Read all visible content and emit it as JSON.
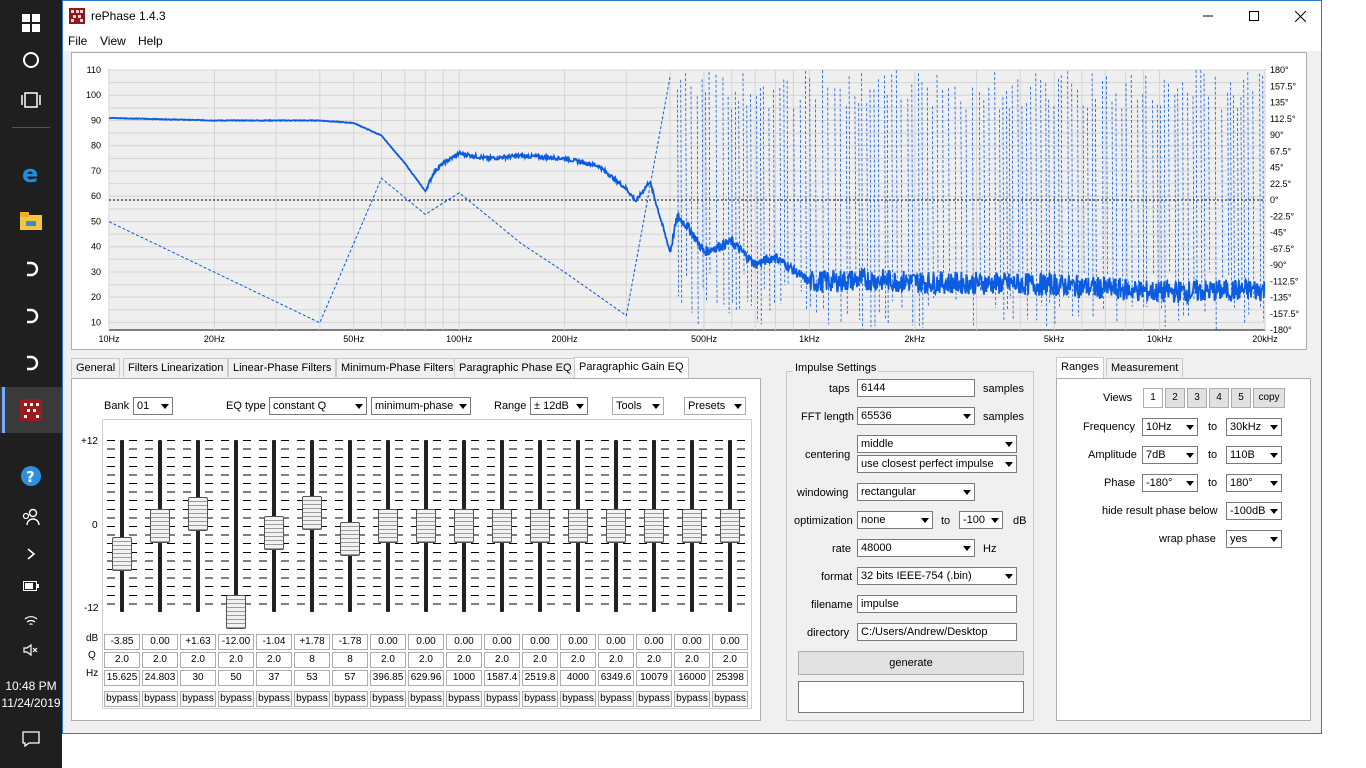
{
  "app": {
    "title": "rePhase 1.4.3"
  },
  "menu": [
    "File",
    "View",
    "Help"
  ],
  "chart_data": {
    "type": "line",
    "title": "",
    "x_ticks": [
      "10Hz",
      "20Hz",
      "50Hz",
      "100Hz",
      "200Hz",
      "500Hz",
      "1kHz",
      "2kHz",
      "5kHz",
      "10kHz",
      "20kHz"
    ],
    "x_range": [
      10,
      20000
    ],
    "y_left_ticks": [
      "110",
      "100",
      "90",
      "80",
      "70",
      "60",
      "50",
      "40",
      "30",
      "20",
      "10"
    ],
    "y_left_range": [
      7,
      110
    ],
    "y_right_ticks": [
      "180°",
      "157.5°",
      "135°",
      "112.5°",
      "90°",
      "67.5°",
      "45°",
      "22.5°",
      "0°",
      "-22.5°",
      "-45°",
      "-67.5°",
      "-90°",
      "-112.5°",
      "-135°",
      "-157.5°",
      "-180°"
    ],
    "y_right_range": [
      -180,
      180
    ],
    "grid": true,
    "series": [
      {
        "kind": "amplitude",
        "x": [
          10,
          20,
          40,
          50,
          60,
          70,
          80,
          85,
          90,
          100,
          120,
          150,
          200,
          250,
          300,
          320,
          350,
          400,
          420,
          450,
          500,
          600,
          700,
          800,
          1000,
          1500,
          2000,
          5000,
          10000,
          20000
        ],
        "y": [
          91,
          90,
          90,
          89,
          84,
          73,
          62,
          70,
          73,
          77,
          75,
          76,
          75,
          72,
          63,
          58,
          66,
          38,
          52,
          48,
          38,
          42,
          33,
          36,
          26,
          27,
          26,
          25,
          22,
          23
        ]
      },
      {
        "kind": "phase (dashed)",
        "x": [
          10,
          20,
          40,
          60,
          80,
          100,
          150,
          200,
          300,
          400
        ],
        "y": [
          -30,
          -100,
          -170,
          30,
          -20,
          10,
          -60,
          -100,
          -160,
          170
        ]
      }
    ]
  },
  "left_tabs": [
    "General",
    "Filters Linearization",
    "Linear-Phase Filters",
    "Minimum-Phase Filters",
    "Paragraphic Phase EQ",
    "Paragraphic Gain EQ"
  ],
  "eq": {
    "bank_label": "Bank",
    "bank_value": "01",
    "eqtype_label": "EQ type",
    "eqtype_value": "constant Q",
    "phase_value": "minimum-phase",
    "range_label": "Range",
    "range_value": "± 12dB",
    "tools_label": "Tools",
    "presets_label": "Presets",
    "scale_top": "+12",
    "scale_mid": "0",
    "scale_bot": "-12",
    "row_db": "dB",
    "row_q": "Q",
    "row_hz": "Hz",
    "bypass": "bypass",
    "channels": [
      {
        "db": "-3.85",
        "q": "2.0",
        "hz": "15.625",
        "gain": -3.85
      },
      {
        "db": "0.00",
        "q": "2.0",
        "hz": "24.803",
        "gain": 0
      },
      {
        "db": "+1.63",
        "q": "2.0",
        "hz": "30",
        "gain": 1.63
      },
      {
        "db": "-12.00",
        "q": "2.0",
        "hz": "50",
        "gain": -12
      },
      {
        "db": "-1.04",
        "q": "2.0",
        "hz": "37",
        "gain": -1.04
      },
      {
        "db": "+1.78",
        "q": "8",
        "hz": "53",
        "gain": 1.78
      },
      {
        "db": "-1.78",
        "q": "8",
        "hz": "57",
        "gain": -1.78
      },
      {
        "db": "0.00",
        "q": "2.0",
        "hz": "396.85",
        "gain": 0
      },
      {
        "db": "0.00",
        "q": "2.0",
        "hz": "629.96",
        "gain": 0
      },
      {
        "db": "0.00",
        "q": "2.0",
        "hz": "1000",
        "gain": 0
      },
      {
        "db": "0.00",
        "q": "2.0",
        "hz": "1587.4",
        "gain": 0
      },
      {
        "db": "0.00",
        "q": "2.0",
        "hz": "2519.8",
        "gain": 0
      },
      {
        "db": "0.00",
        "q": "2.0",
        "hz": "4000",
        "gain": 0
      },
      {
        "db": "0.00",
        "q": "2.0",
        "hz": "6349.6",
        "gain": 0
      },
      {
        "db": "0.00",
        "q": "2.0",
        "hz": "10079",
        "gain": 0
      },
      {
        "db": "0.00",
        "q": "2.0",
        "hz": "16000",
        "gain": 0
      },
      {
        "db": "0.00",
        "q": "2.0",
        "hz": "25398",
        "gain": 0
      }
    ]
  },
  "impulse": {
    "group_title": "Impulse Settings",
    "taps_label": "taps",
    "taps_value": "6144",
    "samples1": "samples",
    "fft_label": "FFT length",
    "fft_value": "65536",
    "samples2": "samples",
    "centering_label": "centering",
    "centering_value": "middle",
    "centering_mode": "use closest perfect impulse",
    "windowing_label": "windowing",
    "windowing_value": "rectangular",
    "optimization_label": "optimization",
    "optimization_value": "none",
    "to_label": "to",
    "opt_db": "-100",
    "db_unit": "dB",
    "rate_label": "rate",
    "rate_value": "48000",
    "hz_unit": "Hz",
    "format_label": "format",
    "format_value": "32 bits IEEE-754 (.bin)",
    "filename_label": "filename",
    "filename_value": "impulse",
    "directory_label": "directory",
    "directory_value": "C:/Users/Andrew/Desktop",
    "generate_label": "generate"
  },
  "ranges": {
    "tabs": [
      "Ranges",
      "Measurement"
    ],
    "views_label": "Views",
    "views": [
      "1",
      "2",
      "3",
      "4",
      "5"
    ],
    "copy_label": "copy",
    "frequency_label": "Frequency",
    "freq_from": "10Hz",
    "freq_to": "30kHz",
    "amplitude_label": "Amplitude",
    "amp_from": "7dB",
    "amp_to": "110B",
    "phase_label": "Phase",
    "phase_from": "-180°",
    "phase_to": "180°",
    "to_label": "to",
    "hide_label": "hide result phase below",
    "hide_value": "-100dB",
    "wrap_label": "wrap phase",
    "wrap_value": "yes"
  },
  "taskbar": {
    "time": "10:48 PM",
    "date": "11/24/2019"
  },
  "colors": {
    "curve": "#0b5ce0",
    "accent": "#2b79d0"
  }
}
